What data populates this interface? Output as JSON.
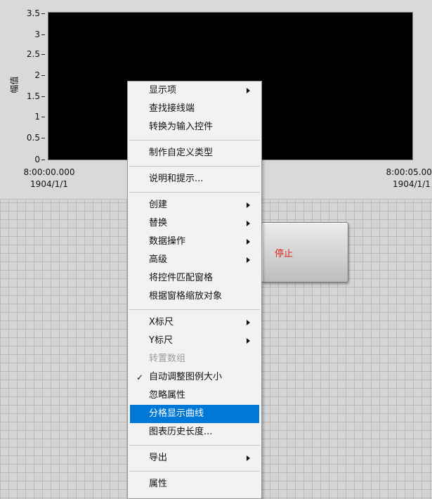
{
  "chart": {
    "y_label": "幅值",
    "y_ticks": [
      "3.5",
      "3",
      "2.5",
      "2",
      "1.5",
      "1",
      "0.5",
      "0"
    ],
    "x_ticks": [
      {
        "time": "8:00:00.000",
        "date": "1904/1/1"
      },
      {
        "time": "8:00:05.000",
        "date": "1904/1/1"
      }
    ]
  },
  "stop_button": {
    "label": "停止",
    "color": "#e0261d"
  },
  "context_menu": {
    "highlight_color": "#0078d7",
    "groups": [
      [
        {
          "label": "显示项",
          "submenu": true
        },
        {
          "label": "查找接线端"
        },
        {
          "label": "转换为输入控件"
        }
      ],
      [
        {
          "label": "制作自定义类型"
        }
      ],
      [
        {
          "label": "说明和提示..."
        }
      ],
      [
        {
          "label": "创建",
          "submenu": true
        },
        {
          "label": "替换",
          "submenu": true
        },
        {
          "label": "数据操作",
          "submenu": true
        },
        {
          "label": "高级",
          "submenu": true
        },
        {
          "label": "将控件匹配窗格"
        },
        {
          "label": "根据窗格缩放对象"
        }
      ],
      [
        {
          "label": "X标尺",
          "submenu": true
        },
        {
          "label": "Y标尺",
          "submenu": true
        },
        {
          "label": "转置数组",
          "disabled": true
        },
        {
          "label": "自动调整图例大小",
          "checked": true
        },
        {
          "label": "忽略属性"
        },
        {
          "label": "分格显示曲线",
          "highlighted": true
        },
        {
          "label": "图表历史长度..."
        }
      ],
      [
        {
          "label": "导出",
          "submenu": true
        }
      ],
      [
        {
          "label": "属性"
        }
      ]
    ]
  }
}
